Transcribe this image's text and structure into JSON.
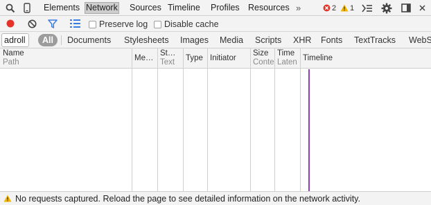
{
  "tabbar": {
    "tabs": [
      {
        "label": "Elements",
        "selected": false
      },
      {
        "label": "Network",
        "selected": true
      },
      {
        "label": "Sources",
        "selected": false
      },
      {
        "label": "Timeline",
        "selected": false
      },
      {
        "label": "Profiles",
        "selected": false
      },
      {
        "label": "Resources",
        "selected": false
      }
    ],
    "more": "»",
    "error_count": "2",
    "warning_count": "1"
  },
  "toolbar": {
    "preserve_log_label": "Preserve log",
    "disable_cache_label": "Disable cache",
    "record_color": "#e5332a",
    "filter_color": "#3a7de1"
  },
  "filterbar": {
    "filter_value": "adroll",
    "types": [
      "All",
      "Documents",
      "Stylesheets",
      "Images",
      "Media",
      "Scripts",
      "XHR",
      "Fonts",
      "TextTracks",
      "WebS"
    ]
  },
  "columns": [
    {
      "title": "Name",
      "subtitle": "Path"
    },
    {
      "title": "Me…",
      "subtitle": ""
    },
    {
      "title": "St…",
      "subtitle": "Text"
    },
    {
      "title": "Type",
      "subtitle": ""
    },
    {
      "title": "Initiator",
      "subtitle": ""
    },
    {
      "title": "Size",
      "subtitle": "Conte"
    },
    {
      "title": "Time",
      "subtitle": "Laten"
    },
    {
      "title": "Timeline",
      "subtitle": ""
    }
  ],
  "status": {
    "message": "No requests captured. Reload the page to see detailed information on the network activity.",
    "warning_color": "#f5b400"
  },
  "timeline_color": "#8d3fb8"
}
